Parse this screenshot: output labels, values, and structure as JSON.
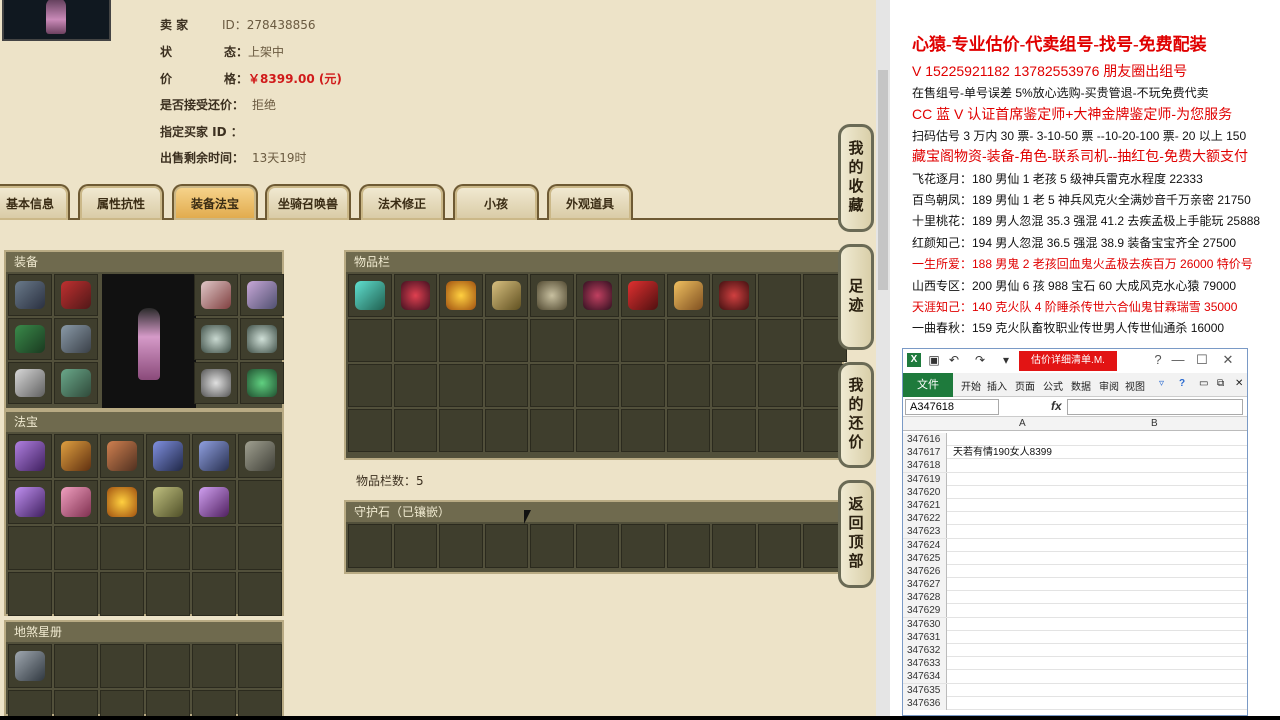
{
  "listing": {
    "seller_label": "卖 家",
    "seller_id": "ID：278438856",
    "status_label": "状",
    "status_mid": "态：",
    "status_value": "上架中",
    "price_label": "价",
    "price_mid": "格：",
    "price_value": "￥8399.00 (元)",
    "bargain_label": "是否接受还价：",
    "bargain_value": "拒绝",
    "buyer_label": "指定买家 ID ：",
    "time_label": "出售剩余时间：",
    "time_value": "13天19时"
  },
  "tabs": [
    "基本信息",
    "属性抗性",
    "装备法宝",
    "坐骑召唤兽",
    "法术修正",
    "小孩",
    "外观道具"
  ],
  "panels": {
    "equip": "装备",
    "fabao": "法宝",
    "dishastar": "地煞星册",
    "bag": "物品栏",
    "guard": "守护石（已镶嵌）"
  },
  "bag_count": "物品栏数：5",
  "side_buttons": [
    "我的收藏",
    "足迹",
    "我的还价",
    "返回顶部"
  ],
  "doc_lines": [
    {
      "text": "心猿-专业估价-代卖组号-找号-免费配装",
      "color": "red",
      "size": "big"
    },
    {
      "text": "V 15225921182   13782553976 朋友圈出组号",
      "color": "red",
      "size": "mid"
    },
    {
      "text": "在售组号-单号误差 5%放心选购-买贵管退-不玩免费代卖",
      "color": "black",
      "size": "normal"
    },
    {
      "text": "CC 蓝 V 认证首席鉴定师+大神金牌鉴定师-为您服务",
      "color": "red",
      "size": "mid"
    },
    {
      "text": "扫码估号 3 万内 30 票- 3-10-50 票  --10-20-100 票- 20 以上 150",
      "color": "black",
      "size": "normal"
    },
    {
      "text": "藏宝阁物资-装备-角色-联系司机--抽红包-免费大额支付",
      "color": "red",
      "size": "mid"
    },
    {
      "text": "飞花逐月：180 男仙 1 老孩 5 级神兵雷克水程度 22333",
      "color": "black",
      "size": "normal"
    },
    {
      "text": "百鸟朝凤：189 男仙 1 老 5 神兵风克火全满妙音千万亲密 21750",
      "color": "black",
      "size": "normal"
    },
    {
      "text": "十里桃花：189 男人忽混 35.3 强混 41.2 去疾孟极上手能玩 25888",
      "color": "black",
      "size": "normal"
    },
    {
      "text": "红颜知己：194 男人忽混 36.5 强混 38.9 装备宝宝齐全 27500",
      "color": "black",
      "size": "normal"
    },
    {
      "text": "一生所爱：188 男鬼 2 老孩回血鬼火孟极去疾百万 26000 特价号",
      "color": "red",
      "size": "normal"
    },
    {
      "text": "山西专区：200 男仙 6 孩 988 宝石 60 大成风克水心猿 79000",
      "color": "black",
      "size": "normal"
    },
    {
      "text": "天涯知己：140 克火队 4 阶睡杀传世六合仙鬼甘霖瑞雪 35000",
      "color": "red",
      "size": "normal"
    },
    {
      "text": "一曲春秋：159 克火队畜牧职业传世男人传世仙通杀 16000",
      "color": "black",
      "size": "normal"
    }
  ],
  "excel": {
    "title_badge": "估价详细清单.M.",
    "file_tab": "文件",
    "ribbon_tabs": [
      "开始",
      "插入",
      "页面",
      "公式",
      "数据",
      "审阅",
      "视图"
    ],
    "name_box": "A347618",
    "fx": "fx",
    "col_a": "A",
    "col_b": "B",
    "rows": [
      {
        "n": "347616",
        "a": ""
      },
      {
        "n": "347617",
        "a": "天若有情190女人8399"
      },
      {
        "n": "347618",
        "a": ""
      },
      {
        "n": "347619",
        "a": ""
      },
      {
        "n": "347620",
        "a": ""
      },
      {
        "n": "347621",
        "a": ""
      },
      {
        "n": "347622",
        "a": ""
      },
      {
        "n": "347623",
        "a": ""
      },
      {
        "n": "347624",
        "a": ""
      },
      {
        "n": "347625",
        "a": ""
      },
      {
        "n": "347626",
        "a": ""
      },
      {
        "n": "347627",
        "a": ""
      },
      {
        "n": "347628",
        "a": ""
      },
      {
        "n": "347629",
        "a": ""
      },
      {
        "n": "347630",
        "a": ""
      },
      {
        "n": "347631",
        "a": ""
      },
      {
        "n": "347632",
        "a": ""
      },
      {
        "n": "347633",
        "a": ""
      },
      {
        "n": "347634",
        "a": ""
      },
      {
        "n": "347635",
        "a": ""
      },
      {
        "n": "347636",
        "a": ""
      }
    ]
  }
}
